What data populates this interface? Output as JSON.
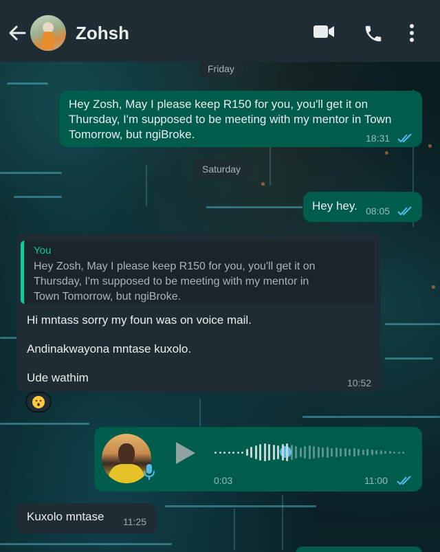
{
  "header": {
    "contact_name": "Zohsh",
    "icons": [
      "back-arrow-icon",
      "video-call-icon",
      "phone-icon",
      "more-vert-icon"
    ]
  },
  "colors": {
    "header_bg": "#1f2c34",
    "outgoing_bubble": "#005c4b",
    "incoming_bubble": "#1f2c34",
    "read_ticks": "#53bdeb",
    "quote_accent": "#06cf9c"
  },
  "chat": {
    "date_friday": "Friday",
    "date_saturday": "Saturday",
    "messages": [
      {
        "direction": "out",
        "lines": [
          "Hey Zosh, May I please keep R150 for you, you'll get it on",
          "Thursday, I'm supposed to be meeting with my mentor in Town",
          "Tomorrow, but ngiBroke."
        ],
        "time": "18:31",
        "status": "read"
      },
      {
        "direction": "out",
        "text": "Hey hey.",
        "time": "08:05",
        "status": "read"
      },
      {
        "direction": "in",
        "quote_author": "You",
        "quote_lines": [
          "Hey Zosh, May I please keep R150 for you, you'll get it on",
          "Thursday, I'm supposed to be meeting with my mentor in",
          "Town Tomorrow, but ngiBroke."
        ],
        "lines": [
          "Hi mntass sorry my foun was on voice mail.",
          "Andinakwayona mntase kuxolo.",
          "Ude wathim"
        ],
        "time": "10:52",
        "reaction": "😮"
      },
      {
        "direction": "out",
        "type": "voice",
        "duration": "0:03",
        "time": "11:00",
        "status": "read",
        "progress": 0.38
      },
      {
        "direction": "in",
        "text": "Kuxolo mntase",
        "time": "11:25"
      }
    ]
  }
}
